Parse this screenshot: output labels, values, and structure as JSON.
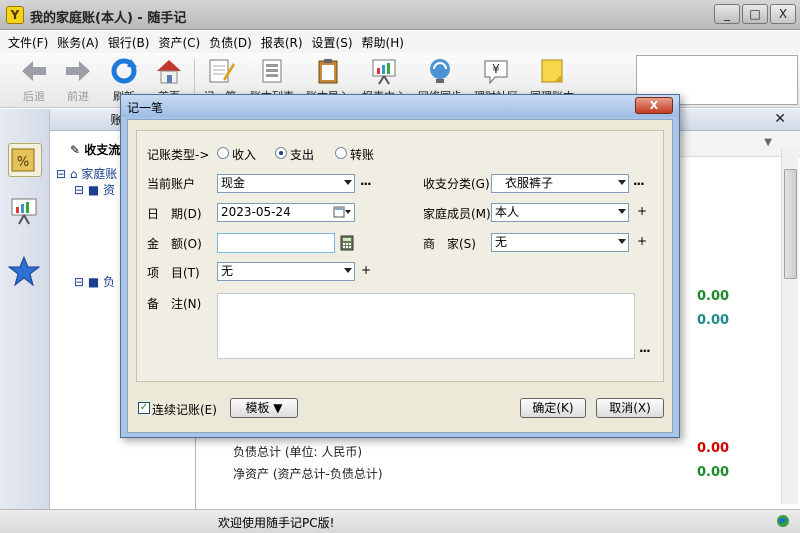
{
  "window": {
    "title": "我的家庭账(本人) - 随手记",
    "app_icon_letter": "Y",
    "min": "_",
    "max": "□",
    "close": "X"
  },
  "menu": [
    "文件(F)",
    "账务(A)",
    "银行(B)",
    "资产(C)",
    "负债(D)",
    "报表(R)",
    "设置(S)",
    "帮助(H)"
  ],
  "toolbar": {
    "back": "后退",
    "forward": "前进",
    "refresh": "刷新",
    "home": "首页",
    "record": "记一笔",
    "list": "账本列表",
    "import": "账本导入",
    "report": "报表中心",
    "sync": "网络同步",
    "exchange": "理财社区",
    "notes": "同理账本"
  },
  "left_panel": {
    "header": "账务",
    "section": "收支流",
    "tree_root": "家庭账",
    "node_assets": "资",
    "node_debts": "负"
  },
  "right_panel": {
    "amount1": "0.00",
    "amount2": "0.00",
    "debt_total_label": "负债总计 (单位: 人民币)",
    "debt_total_value": "0.00",
    "net_assets_label": "净资产 (资产总计-负债总计)",
    "net_assets_value": "0.00"
  },
  "status": {
    "text": "欢迎使用随手记PC版!"
  },
  "dialog": {
    "title": "记一笔",
    "close": "X",
    "type_label": "记账类型->",
    "type_income": "收入",
    "type_expense": "支出",
    "type_transfer": "转账",
    "account_label": "当前账户",
    "account_value": "现金",
    "category_label": "收支分类(G)",
    "category_value": "衣服裤子",
    "date_label": "日　期(D)",
    "date_value": "2023-05-24",
    "member_label": "家庭成员(M)",
    "member_value": "本人",
    "amount_label": "金　额(O)",
    "amount_value": "",
    "merchant_label": "商　家(S)",
    "merchant_value": "无",
    "project_label": "项　目(T)",
    "project_value": "无",
    "note_label": "备　注(N)",
    "more": "...",
    "plus": "+",
    "continuous_label": "连续记账(E)",
    "template_label": "模板 ▼",
    "ok_label": "确定(K)",
    "cancel_label": "取消(X)",
    "selected_type": "支出",
    "continuous_checked": true
  }
}
